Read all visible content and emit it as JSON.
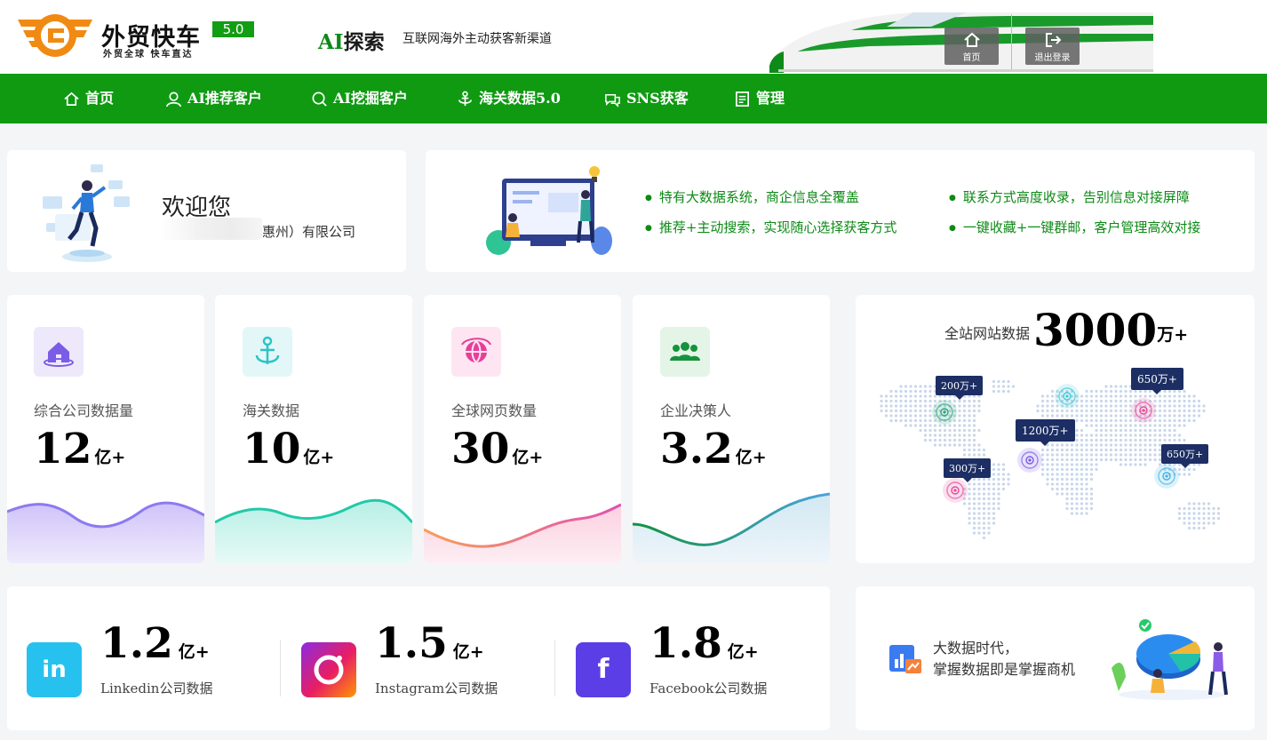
{
  "header": {
    "logo_title": "外贸快车",
    "logo_version": "5.0",
    "logo_subtitle": "外贸全球 快车直达",
    "ai_title_ai": "AI",
    "ai_title_rest": "探索",
    "slogan": "互联网海外主动获客新渠道",
    "home_button": "首页",
    "logout_button": "退出登录"
  },
  "nav": {
    "items": [
      {
        "label": "首页",
        "icon": "home-icon"
      },
      {
        "label": "AI推荐客户",
        "icon": "user-icon"
      },
      {
        "label": "AI挖掘客户",
        "icon": "search-icon"
      },
      {
        "label": "海关数据5.0",
        "icon": "anchor-icon"
      },
      {
        "label": "SNS获客",
        "icon": "chat-icon"
      },
      {
        "label": "管理",
        "icon": "list-icon"
      }
    ]
  },
  "welcome": {
    "title": "欢迎您",
    "company": "惠州）有限公司"
  },
  "features": [
    "特有大数据系统，商企信息全覆盖",
    "联系方式高度收录，告别信息对接屏障",
    "推荐+主动搜索，实现随心选择获客方式",
    "一键收藏+一键群邮，客户管理高效对接"
  ],
  "stats": [
    {
      "label": "综合公司数据量",
      "value": "12",
      "unit": "亿+",
      "icon": "house-icon",
      "color": "#7b5ce6"
    },
    {
      "label": "海关数据",
      "value": "10",
      "unit": "亿+",
      "icon": "anchor-icon",
      "color": "#2cc3c8"
    },
    {
      "label": "全球网页数量",
      "value": "30",
      "unit": "亿+",
      "icon": "globe-icon",
      "color": "#e83e9a"
    },
    {
      "label": "企业决策人",
      "value": "3.2",
      "unit": "亿+",
      "icon": "people-icon",
      "color": "#17923c"
    }
  ],
  "map": {
    "label": "全站网站数据",
    "value": "3000",
    "unit": "万+",
    "tips": [
      "200万+",
      "650万+",
      "1200万+",
      "300万+",
      "650万+"
    ]
  },
  "social": [
    {
      "value": "1.2",
      "unit": "亿+",
      "label": "Linkedin公司数据",
      "icon_text": "in",
      "icon": "linkedin-icon"
    },
    {
      "value": "1.5",
      "unit": "亿+",
      "label": "Instagram公司数据",
      "icon_text": "",
      "icon": "instagram-icon"
    },
    {
      "value": "1.8",
      "unit": "亿+",
      "label": "Facebook公司数据",
      "icon_text": "f",
      "icon": "facebook-icon"
    }
  ],
  "bigdata": {
    "line1": "大数据时代，",
    "line2": "掌握数据即是掌握商机"
  }
}
